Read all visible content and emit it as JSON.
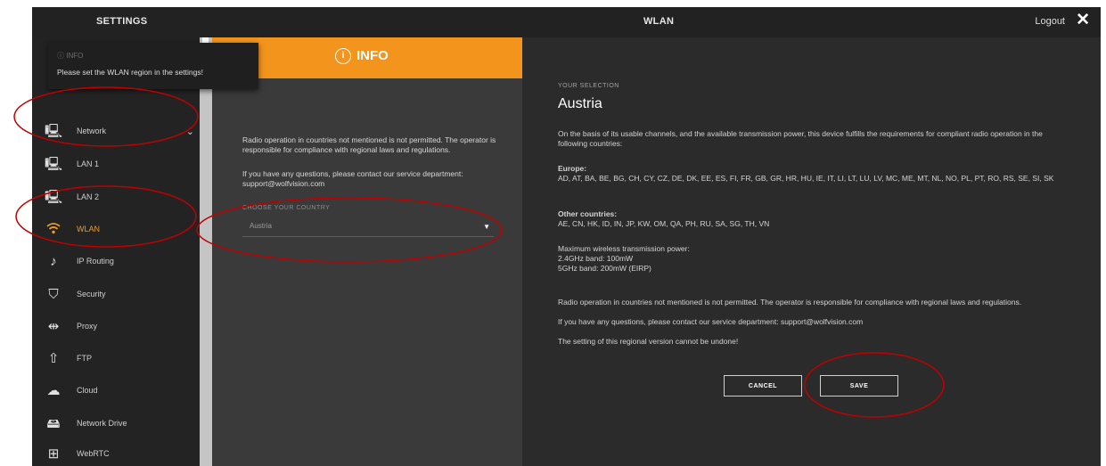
{
  "header": {
    "settings_title": "SETTINGS",
    "page_title": "WLAN",
    "logout": "Logout",
    "close": "✕"
  },
  "toast": {
    "title": "ⓘ INFO",
    "message": "Please set the WLAN region in the settings!"
  },
  "sidebar": {
    "items": [
      {
        "label": "Network",
        "icon": "network-icon",
        "glyph": "🖳"
      },
      {
        "label": "LAN 1",
        "icon": "lan-icon",
        "glyph": "🖳"
      },
      {
        "label": "LAN 2",
        "icon": "lan-icon",
        "glyph": "🖳"
      },
      {
        "label": "WLAN",
        "icon": "wifi-icon",
        "glyph": "◡"
      },
      {
        "label": "IP Routing",
        "icon": "routing-icon",
        "glyph": "♪"
      },
      {
        "label": "Security",
        "icon": "shield-icon",
        "glyph": "⛉"
      },
      {
        "label": "Proxy",
        "icon": "proxy-icon",
        "glyph": "⇹"
      },
      {
        "label": "FTP",
        "icon": "upload-icon",
        "glyph": "⇧"
      },
      {
        "label": "Cloud",
        "icon": "cloud-icon",
        "glyph": "☁"
      },
      {
        "label": "Network Drive",
        "icon": "drive-icon",
        "glyph": "🖴"
      },
      {
        "label": "WebRTC",
        "icon": "webrtc-icon",
        "glyph": "⊞"
      }
    ],
    "expanded_chevron": "⌄"
  },
  "info_panel": {
    "title": "INFO",
    "icon_glyph": "i",
    "text1": "Radio operation in countries not mentioned is not permitted. The operator is responsible for compliance with regional laws and regulations.",
    "text2": "If you have any questions, please contact our service department: support@wolfvision.com",
    "choose_label": "CHOOSE YOUR COUNTRY",
    "selected_country": "Austria",
    "caret": "▼"
  },
  "main": {
    "your_selection_label": "YOUR SELECTION",
    "country": "Austria",
    "intro": "On the basis of its usable channels, and the available transmission power, this device fulfills the requirements for compliant radio operation in the following countries:",
    "europe_heading": "Europe:",
    "europe_list": "AD, AT, BA, BE, BG, CH, CY, CZ, DE, DK, EE, ES, FI, FR, GB, GR, HR, HU, IE, IT, LI, LT, LU, LV, MC, ME, MT, NL, NO, PL, PT, RO, RS, SE, SI, SK",
    "other_heading": "Other countries:",
    "other_list": "AE, CN, HK, ID, IN, JP, KW, OM, QA, PH, RU, SA, SG, TH, VN",
    "power_heading": "Maximum wireless transmission power:",
    "power_24": "2.4GHz band: 100mW",
    "power_5": "5GHz band: 200mW (EIRP)",
    "disclaimer1": "Radio operation in countries not mentioned is not permitted. The operator is responsible for compliance with regional laws and regulations.",
    "disclaimer2": "If you have any questions, please contact our service department: support@wolfvision.com",
    "warning": "The setting of this regional version cannot be undone!",
    "cancel": "CANCEL",
    "save": "SAVE"
  },
  "colors": {
    "accent": "#f3941c",
    "annotation": "#c00000"
  }
}
